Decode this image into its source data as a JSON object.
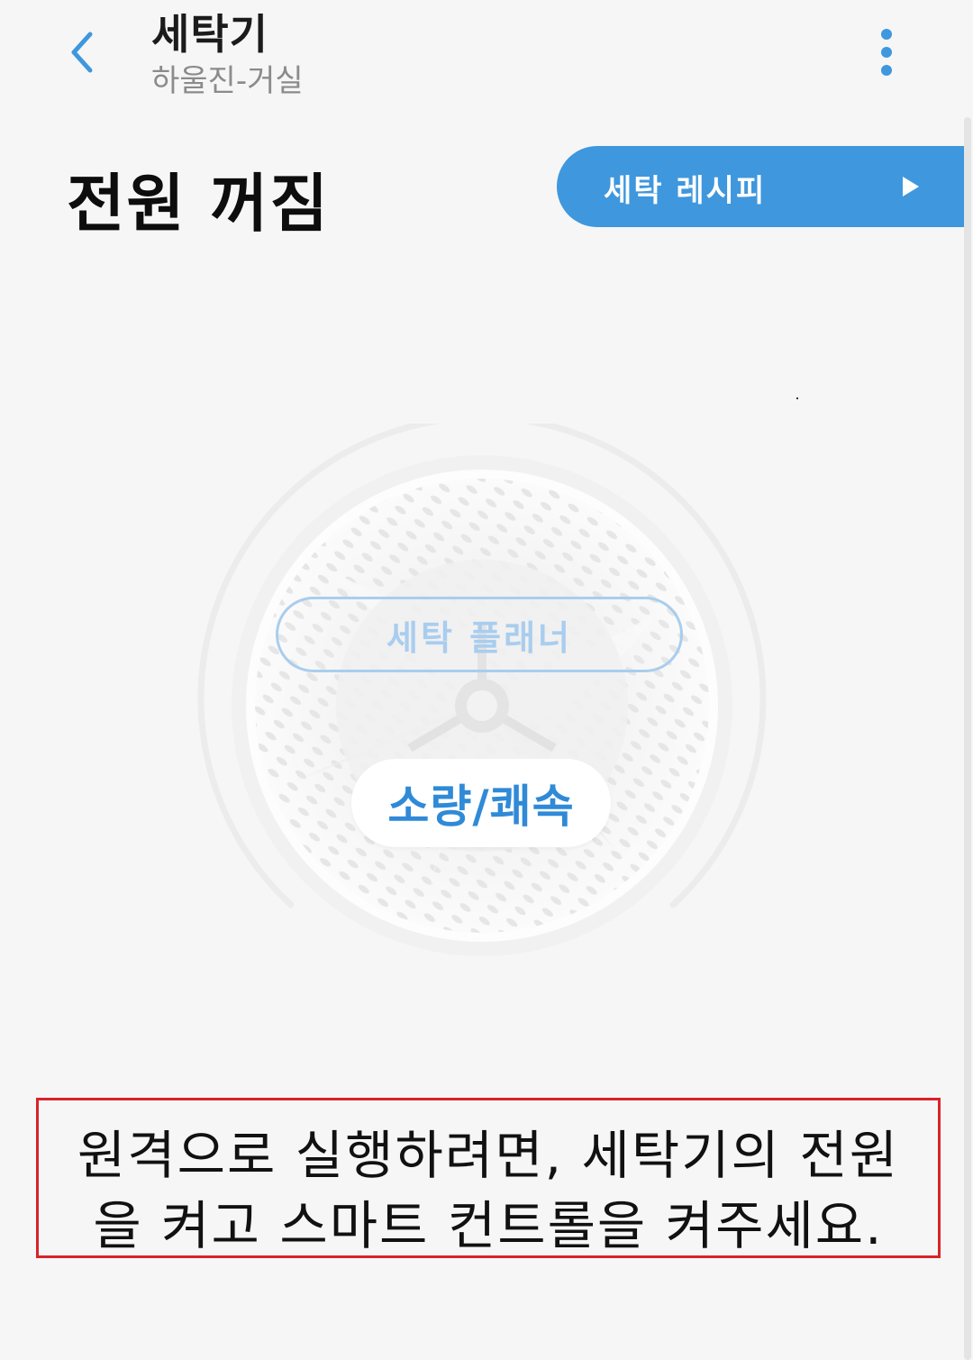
{
  "header": {
    "title": "세탁기",
    "subtitle": "하울진-거실"
  },
  "status": {
    "power_text": "전원 꺼짐"
  },
  "recipe_button": {
    "label": "세탁 레시피"
  },
  "drum": {
    "planner_label": "세탁 플래너",
    "course_label": "소량/쾌속"
  },
  "notice": {
    "line1": "원격으로 실행하려면, 세탁기의 전원",
    "line2": "을 켜고 스마트 컨트롤을 켜주세요."
  },
  "colors": {
    "accent": "#3f97dd",
    "notice_border": "#d7232c",
    "background": "#f6f6f6"
  },
  "icons": {
    "back": "chevron-left-icon",
    "more": "more-vertical-icon",
    "arrow": "play-arrow-icon"
  }
}
